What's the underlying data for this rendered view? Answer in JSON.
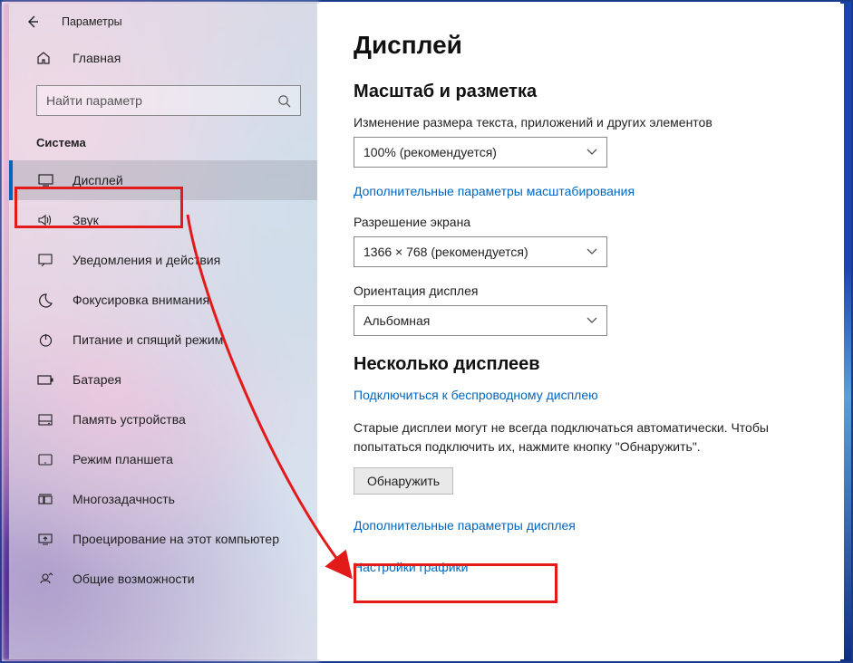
{
  "header": {
    "app_title": "Параметры"
  },
  "sidebar": {
    "home_label": "Главная",
    "search_placeholder": "Найти параметр",
    "section_label": "Система",
    "items": [
      {
        "label": "Дисплей"
      },
      {
        "label": "Звук"
      },
      {
        "label": "Уведомления и действия"
      },
      {
        "label": "Фокусировка внимания"
      },
      {
        "label": "Питание и спящий режим"
      },
      {
        "label": "Батарея"
      },
      {
        "label": "Память устройства"
      },
      {
        "label": "Режим планшета"
      },
      {
        "label": "Многозадачность"
      },
      {
        "label": "Проецирование на этот компьютер"
      },
      {
        "label": "Общие возможности"
      }
    ]
  },
  "content": {
    "page_title": "Дисплей",
    "scale_section": "Масштаб и разметка",
    "scale_label": "Изменение размера текста, приложений и других элементов",
    "scale_value": "100% (рекомендуется)",
    "scale_link": "Дополнительные параметры масштабирования",
    "res_label": "Разрешение экрана",
    "res_value": "1366 × 768 (рекомендуется)",
    "orient_label": "Ориентация дисплея",
    "orient_value": "Альбомная",
    "multi_section": "Несколько дисплеев",
    "wireless_link": "Подключиться к беспроводному дисплею",
    "multi_para": "Старые дисплеи могут не всегда подключаться автоматически. Чтобы попытаться подключить их, нажмите кнопку \"Обнаружить\".",
    "detect_btn": "Обнаружить",
    "adv_link": "Дополнительные параметры дисплея",
    "graphics_link": "Настройки графики"
  }
}
